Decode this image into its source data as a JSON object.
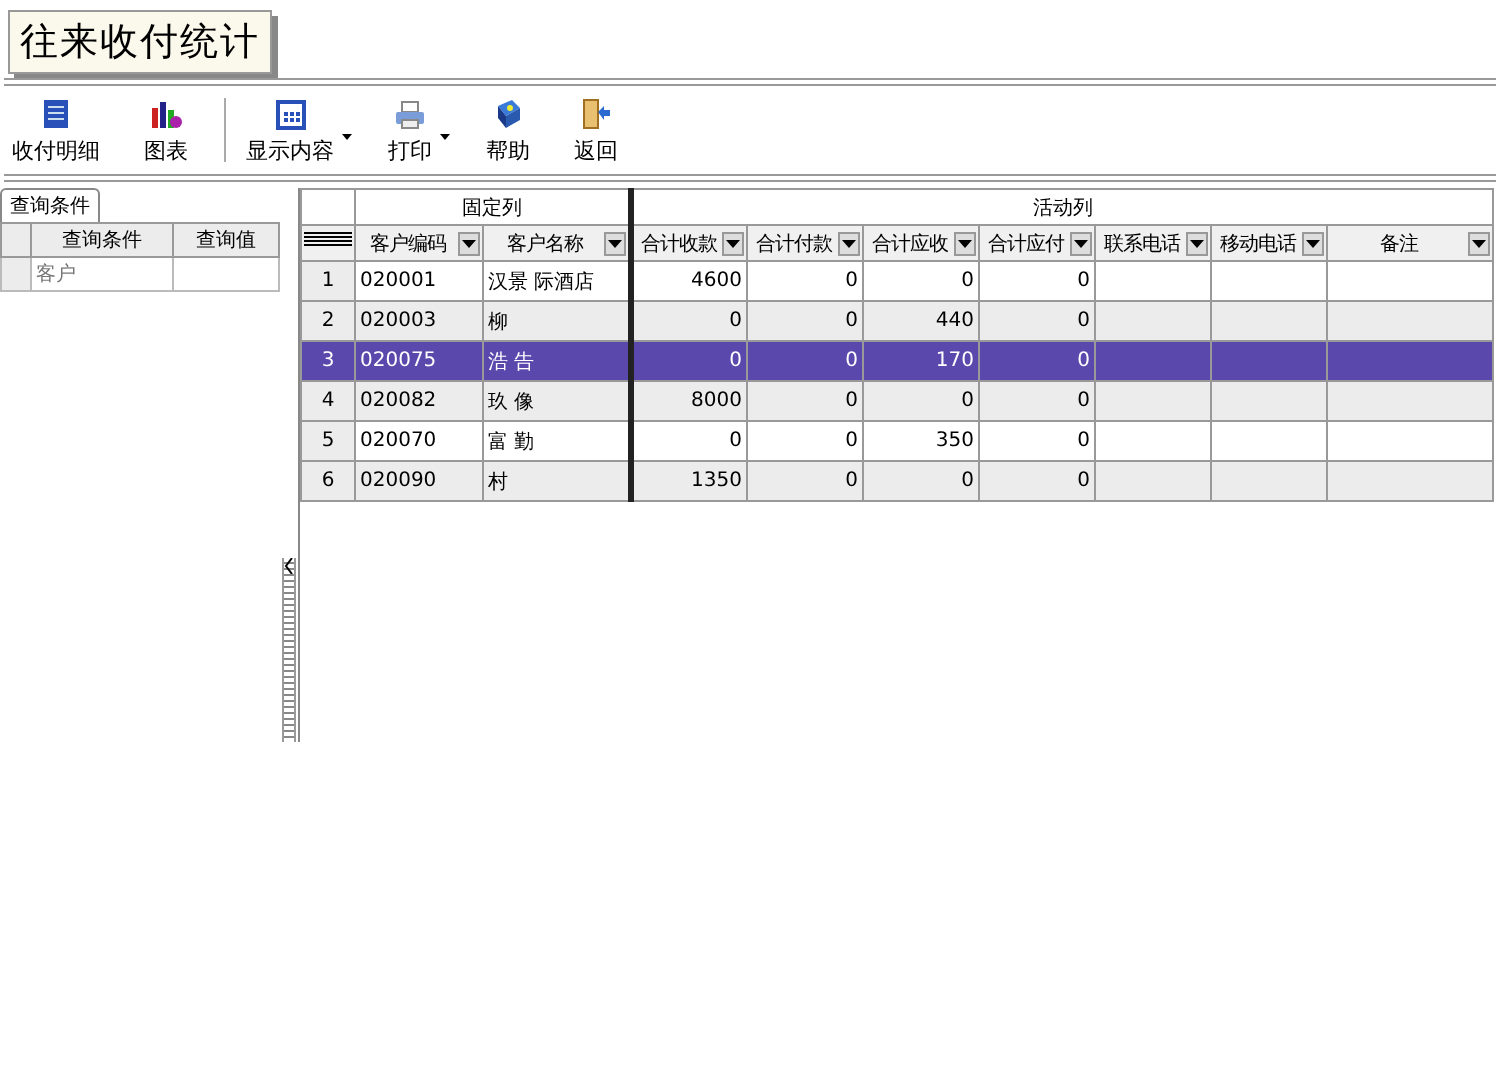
{
  "title": "往来收付统计",
  "toolbar": [
    {
      "label": "收付明细",
      "dropdown": false
    },
    {
      "label": "图表",
      "dropdown": false
    },
    {
      "label": "显示内容",
      "dropdown": true
    },
    {
      "label": "打印",
      "dropdown": true
    },
    {
      "label": "帮助",
      "dropdown": false
    },
    {
      "label": "返回",
      "dropdown": false
    }
  ],
  "query_panel": {
    "tab": "查询条件",
    "columns": [
      "查询条件",
      "查询值"
    ],
    "rows": [
      {
        "condition": "客户",
        "value": ""
      }
    ]
  },
  "grid": {
    "groups": [
      "固定列",
      "活动列"
    ],
    "columns": [
      {
        "label": "客户编码",
        "kind": "text"
      },
      {
        "label": "客户名称",
        "kind": "text"
      },
      {
        "label": "合计收款",
        "kind": "amount"
      },
      {
        "label": "合计付款",
        "kind": "amount"
      },
      {
        "label": "合计应收",
        "kind": "amount"
      },
      {
        "label": "合计应付",
        "kind": "amount"
      },
      {
        "label": "联系电话",
        "kind": "text"
      },
      {
        "label": "移动电话",
        "kind": "text"
      },
      {
        "label": "备注",
        "kind": "text"
      }
    ],
    "rows": [
      {
        "num": "1",
        "selected": false,
        "cells": [
          "020001",
          "汉景 际酒店",
          "4600",
          "0",
          "0",
          "0",
          "",
          "",
          ""
        ]
      },
      {
        "num": "2",
        "selected": false,
        "cells": [
          "020003",
          "柳",
          "0",
          "0",
          "440",
          "0",
          "",
          "",
          ""
        ]
      },
      {
        "num": "3",
        "selected": true,
        "cells": [
          "020075",
          "浩  告",
          "0",
          "0",
          "170",
          "0",
          "",
          "",
          ""
        ]
      },
      {
        "num": "4",
        "selected": false,
        "cells": [
          "020082",
          "玖  像",
          "8000",
          "0",
          "0",
          "0",
          "",
          "",
          ""
        ]
      },
      {
        "num": "5",
        "selected": false,
        "cells": [
          "020070",
          "富 勤",
          "0",
          "0",
          "350",
          "0",
          "",
          "",
          ""
        ]
      },
      {
        "num": "6",
        "selected": false,
        "cells": [
          "020090",
          "村",
          "1350",
          "0",
          "0",
          "0",
          "",
          "",
          ""
        ]
      }
    ]
  }
}
